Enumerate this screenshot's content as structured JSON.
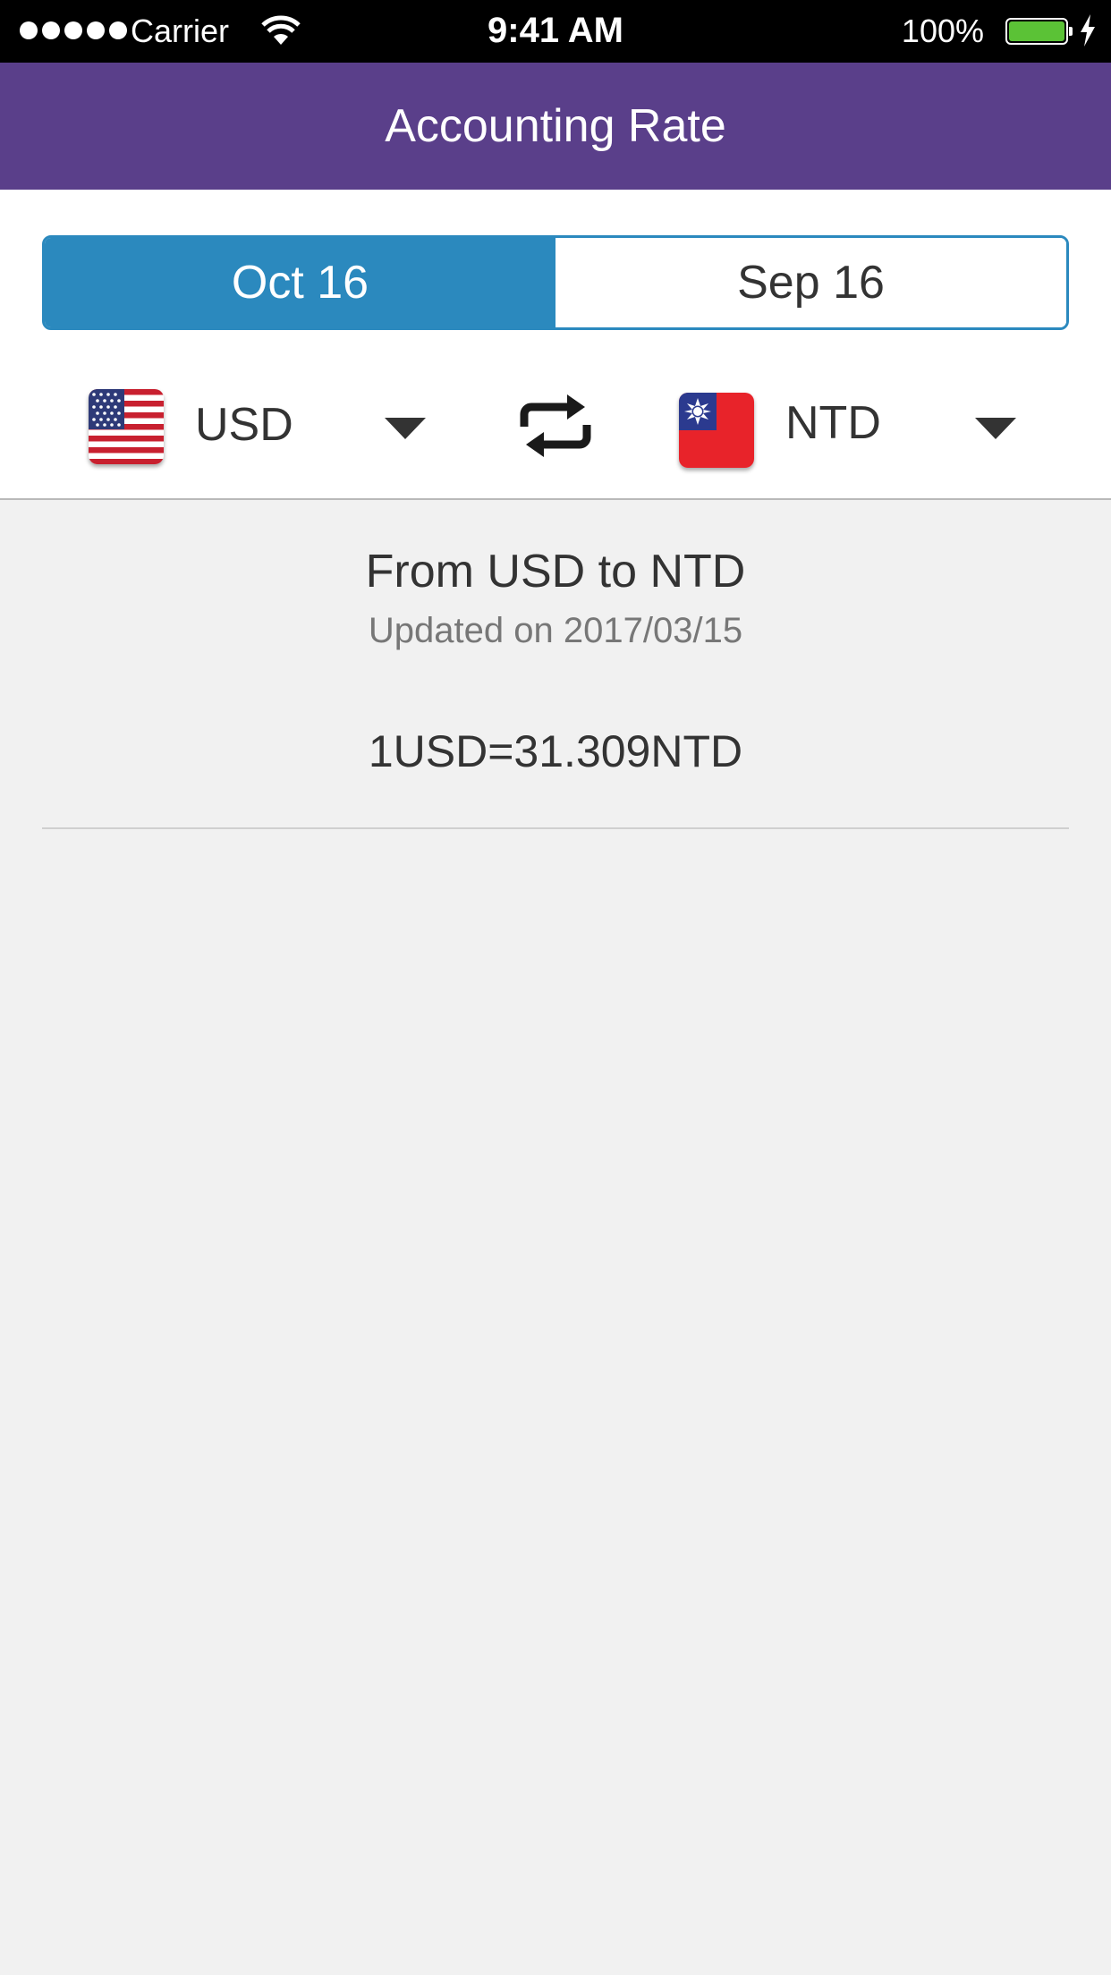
{
  "status_bar": {
    "carrier": "Carrier",
    "time": "9:41 AM",
    "battery": "100%",
    "battery_level": 1.0
  },
  "nav": {
    "title": "Accounting Rate"
  },
  "tabs": [
    {
      "label": "Oct 16",
      "selected": true
    },
    {
      "label": "Sep 16",
      "selected": false
    }
  ],
  "from_currency": {
    "code": "USD",
    "flag": "us-flag-icon"
  },
  "to_currency": {
    "code": "NTD",
    "flag": "taiwan-flag-icon"
  },
  "result": {
    "title": "From USD to NTD",
    "updated": "Updated on 2017/03/15",
    "rate": "1USD=31.309NTD"
  },
  "colors": {
    "nav_bg": "#5a3f8a",
    "accent": "#2b89be",
    "background": "#f1f1f1",
    "battery": "#5bc236"
  }
}
